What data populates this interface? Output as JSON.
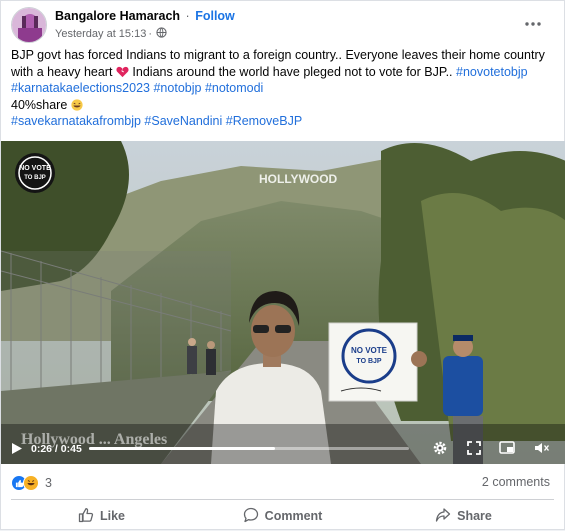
{
  "post": {
    "author": "Bangalore Hamarach",
    "separator": "·",
    "follow_label": "Follow",
    "timestamp": "Yesterday at 15:13",
    "timestamp_sep": "·",
    "text_line1": "BJP govt has forced Indians to migrant to a foreign country.. Everyone leaves their home country with a heavy heart",
    "text_line1_after": " Indians around the world have pleged not to vote for BJP.. ",
    "hashtags_line1": "#novotetobjp",
    "hashtags_line2": [
      "#karnatakaelections2023",
      "#notobjp",
      "#notomodi"
    ],
    "share_text": "40%share",
    "hashtags_line3": [
      "#savekarnatakafrombjp",
      "#SaveNandini",
      "#RemoveBJP"
    ]
  },
  "video": {
    "current_time": "0:26",
    "duration": "0:45",
    "time_sep": " / ",
    "progress": 0.58,
    "watermark_text": "NO VOTE TO BJP",
    "sign_text": "NO VOTE TO BJP",
    "hollywood_sign": "HOLLYWOOD",
    "caption_overlay": "Hollywood ... Angeles"
  },
  "reactions": {
    "count": "3",
    "icons": [
      "like-icon",
      "haha-icon"
    ]
  },
  "comments": {
    "label": "2 comments"
  },
  "actions": {
    "like": "Like",
    "comment": "Comment",
    "share": "Share"
  },
  "colors": {
    "accent": "#1b74e4",
    "hashtag": "#216fdb",
    "muted": "#65676b",
    "like_blue": "#1877f2",
    "haha_yellow": "#f7b125"
  }
}
